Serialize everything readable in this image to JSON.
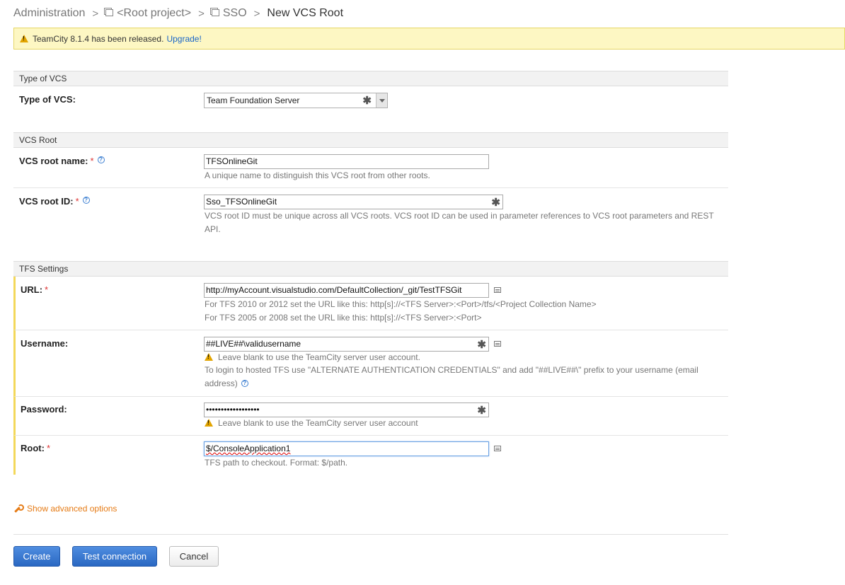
{
  "breadcrumb": {
    "items": [
      "Administration",
      "<Root project>",
      "SSO"
    ],
    "current": "New VCS Root"
  },
  "banner": {
    "text": "TeamCity 8.1.4 has been released.",
    "link": "Upgrade!"
  },
  "sections": {
    "type_of_vcs": "Type of VCS",
    "vcs_root": "VCS Root",
    "tfs_settings": "TFS Settings"
  },
  "vcs_type": {
    "label": "Type of VCS:",
    "value": "Team Foundation Server"
  },
  "root_name": {
    "label": "VCS root name:",
    "required": "*",
    "value": "TFSOnlineGit",
    "note": "A unique name to distinguish this VCS root from other roots."
  },
  "root_id": {
    "label": "VCS root ID:",
    "required": "*",
    "value": "Sso_TFSOnlineGit",
    "note": "VCS root ID must be unique across all VCS roots. VCS root ID can be used in parameter references to VCS root parameters and REST API."
  },
  "url": {
    "label": "URL:",
    "required": "*",
    "value": "http://myAccount.visualstudio.com/DefaultCollection/_git/TestTFSGit",
    "note1": "For TFS 2010 or 2012 set the URL like this: http[s]://<TFS Server>:<Port>/tfs/<Project Collection Name>",
    "note2": "For TFS 2005 or 2008 set the URL like this: http[s]://<TFS Server>:<Port>"
  },
  "username": {
    "label": "Username:",
    "value": "##LIVE##\\validusername",
    "warning": "Leave blank to use the TeamCity server user account.",
    "note": "To login to hosted TFS use \"ALTERNATE AUTHENTICATION CREDENTIALS\" and add \"##LIVE##\\\" prefix to your username (email address)"
  },
  "password": {
    "label": "Password:",
    "value": "••••••••••••••••••",
    "warning": "Leave blank to use the TeamCity server user account"
  },
  "root": {
    "label": "Root:",
    "required": "*",
    "value": "$/ConsoleApplication1",
    "note": "TFS path to checkout. Format: $/path."
  },
  "advanced": "Show advanced options",
  "buttons": {
    "create": "Create",
    "test": "Test connection",
    "cancel": "Cancel"
  },
  "colors": {
    "accent": "#2a68c2",
    "banner": "#fdf7c3",
    "link": "#1a66c8",
    "advanced": "#e57a14",
    "required": "#d33333",
    "tfs_bar": "#f3d85a"
  }
}
